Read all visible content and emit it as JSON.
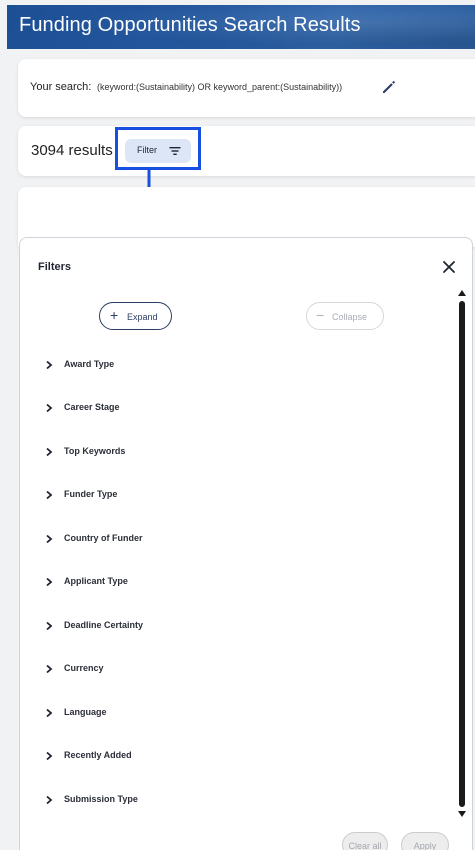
{
  "header": {
    "title": "Funding Opportunities Search Results"
  },
  "search": {
    "label": "Your search:",
    "query": "(keyword:(Sustainability) OR keyword_parent:(Sustainability))",
    "edit_icon": "pencil-icon"
  },
  "results": {
    "count_text": "3094 results",
    "filter_button_label": "Filter",
    "filter_icon": "filter-lines-icon"
  },
  "annotation": {
    "highlight_color": "#1750e0"
  },
  "filters_panel": {
    "title": "Filters",
    "close_icon": "close-icon",
    "expand_label": "Expand",
    "collapse_label": "Collapse",
    "items": [
      {
        "label": "Award Type"
      },
      {
        "label": "Career Stage"
      },
      {
        "label": "Top Keywords"
      },
      {
        "label": "Funder Type"
      },
      {
        "label": "Country of Funder"
      },
      {
        "label": "Applicant Type"
      },
      {
        "label": "Deadline Certainty"
      },
      {
        "label": "Currency"
      },
      {
        "label": "Language"
      },
      {
        "label": "Recently Added"
      },
      {
        "label": "Submission Type"
      }
    ],
    "clear_all_label": "Clear all",
    "apply_label": "Apply"
  },
  "colors": {
    "header_blue": "#24589f",
    "filter_button_bg": "#dce6f6",
    "expand_border": "#2c3e63"
  }
}
